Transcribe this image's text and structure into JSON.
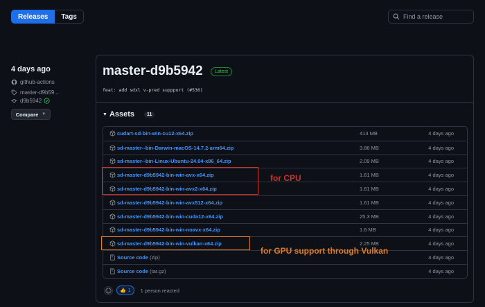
{
  "tabs": {
    "releases": "Releases",
    "tags": "Tags"
  },
  "search": {
    "placeholder": "Find a release"
  },
  "sidebar": {
    "time_ago": "4 days ago",
    "author": "github-actions",
    "tag": "master-d9b59...",
    "commit": "d9b5942",
    "compare_label": "Compare"
  },
  "release": {
    "title": "master-d9b5942",
    "badge": "Latest",
    "description": "feat: add sdxl v-pred suppport (#536)"
  },
  "assets": {
    "heading": "Assets",
    "count": "11",
    "items": [
      {
        "name": "cudart-sd-bin-win-cu12-x64.zip",
        "size": "413 MB",
        "date": "4 days ago"
      },
      {
        "name": "sd-master--bin-Darwin-macOS-14.7.2-arm64.zip",
        "size": "3.86 MB",
        "date": "4 days ago"
      },
      {
        "name": "sd-master--bin-Linux-Ubuntu-24.04-x86_64.zip",
        "size": "2.09 MB",
        "date": "4 days ago"
      },
      {
        "name": "sd-master-d9b5942-bin-win-avx-x64.zip",
        "size": "1.61 MB",
        "date": "4 days ago"
      },
      {
        "name": "sd-master-d9b5942-bin-win-avx2-x64.zip",
        "size": "1.61 MB",
        "date": "4 days ago"
      },
      {
        "name": "sd-master-d9b5942-bin-win-avx512-x64.zip",
        "size": "1.61 MB",
        "date": "4 days ago"
      },
      {
        "name": "sd-master-d9b5942-bin-win-cuda12-x64.zip",
        "size": "25.3 MB",
        "date": "4 days ago"
      },
      {
        "name": "sd-master-d9b5942-bin-win-noavx-x64.zip",
        "size": "1.6 MB",
        "date": "4 days ago"
      },
      {
        "name": "sd-master-d9b5942-bin-win-vulkan-x64.zip",
        "size": "2.25 MB",
        "date": "4 days ago"
      }
    ],
    "source_zip": {
      "label": "Source code",
      "ext": "(zip)",
      "date": "4 days ago"
    },
    "source_tar": {
      "label": "Source code",
      "ext": "(tar.gz)",
      "date": "4 days ago"
    }
  },
  "reactions": {
    "thumbs_count": "1",
    "people_text": "1 person reacted"
  },
  "annotations": {
    "cpu_label": "for CPU",
    "gpu_label": "for GPU support through Vulkan",
    "cpu_color": "#d0302a",
    "gpu_color": "#e07b28"
  }
}
